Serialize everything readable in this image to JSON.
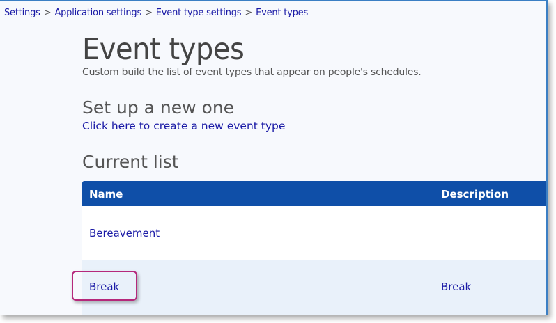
{
  "breadcrumb": {
    "items": [
      "Settings",
      "Application settings",
      "Event type settings",
      "Event types"
    ],
    "separator": ">"
  },
  "page": {
    "title": "Event types",
    "subtitle": "Custom build the list of event types that appear on people's schedules."
  },
  "setup": {
    "heading": "Set up a new one",
    "link": "Click here to create a new event type"
  },
  "current": {
    "heading": "Current list",
    "columns": [
      "Name",
      "Description"
    ],
    "rows": [
      {
        "name": "Bereavement",
        "description": ""
      },
      {
        "name": "Break",
        "description": "Break"
      }
    ]
  },
  "colors": {
    "header_bg": "#0f4fa8",
    "link": "#1a1aa6",
    "highlight": "#b5287b",
    "alt_row": "#e9f1fa"
  }
}
